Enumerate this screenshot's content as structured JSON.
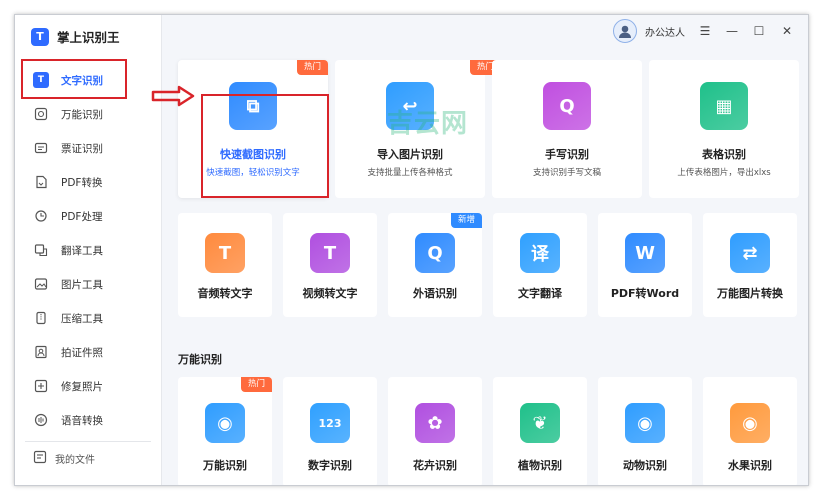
{
  "app": {
    "title": "掌上识别王",
    "logo_glyph": "T"
  },
  "user": {
    "name": "办公达人"
  },
  "window_controls": [
    "☰",
    "—",
    "☐",
    "✕"
  ],
  "sidebar": {
    "items": [
      {
        "label": "文字识别",
        "icon": "text-icon",
        "active": true
      },
      {
        "label": "万能识别",
        "icon": "scan-icon"
      },
      {
        "label": "票证识别",
        "icon": "ticket-icon"
      },
      {
        "label": "PDF转换",
        "icon": "pdf-convert-icon"
      },
      {
        "label": "PDF处理",
        "icon": "pdf-process-icon"
      },
      {
        "label": "翻译工具",
        "icon": "translate-icon"
      },
      {
        "label": "图片工具",
        "icon": "image-icon"
      },
      {
        "label": "压缩工具",
        "icon": "compress-icon"
      },
      {
        "label": "拍证件照",
        "icon": "id-photo-icon"
      },
      {
        "label": "修复照片",
        "icon": "repair-icon"
      },
      {
        "label": "语音转换",
        "icon": "voice-icon"
      }
    ],
    "bottom": {
      "label": "我的文件",
      "icon": "file-icon"
    }
  },
  "top_cards": [
    {
      "title": "快速截图识别",
      "sub": "快速截图，轻松识别文字",
      "badge": "热门",
      "color": "#2f8bff",
      "glyph": "⧉"
    },
    {
      "title": "导入图片识别",
      "sub": "支持批量上传各种格式",
      "badge": "热门",
      "color": "#2f9dff",
      "glyph": "↩"
    },
    {
      "title": "手写识别",
      "sub": "支持识别手写文稿",
      "badge": "",
      "color": "#c04fe0",
      "glyph": "Q"
    },
    {
      "title": "表格识别",
      "sub": "上传表格图片，导出xlxs",
      "badge": "",
      "color": "#1fc08a",
      "glyph": "▦"
    }
  ],
  "tools": [
    {
      "title": "音频转文字",
      "badge": "",
      "color": "#ff8a3d",
      "glyph": "T"
    },
    {
      "title": "视频转文字",
      "badge": "",
      "color": "#b04fe0",
      "glyph": "T"
    },
    {
      "title": "外语识别",
      "badge": "新增",
      "color": "#2f8bff",
      "glyph": "Q"
    },
    {
      "title": "文字翻译",
      "badge": "",
      "color": "#2fa0ff",
      "glyph": "译"
    },
    {
      "title": "PDF转Word",
      "badge": "",
      "color": "#2f8bff",
      "glyph": "W"
    },
    {
      "title": "万能图片转换",
      "badge": "",
      "color": "#2f9dff",
      "glyph": "⇄"
    }
  ],
  "section": {
    "title": "万能识别"
  },
  "universal": [
    {
      "title": "万能识别",
      "badge": "热门",
      "color": "#2f9dff",
      "glyph": "◉"
    },
    {
      "title": "数字识别",
      "badge": "",
      "color": "#2fa0ff",
      "glyph": "123"
    },
    {
      "title": "花卉识别",
      "badge": "",
      "color": "#b04fe0",
      "glyph": "✿"
    },
    {
      "title": "植物识别",
      "badge": "",
      "color": "#1fc08a",
      "glyph": "❦"
    },
    {
      "title": "动物识别",
      "badge": "",
      "color": "#2f9dff",
      "glyph": "◉"
    },
    {
      "title": "水果识别",
      "badge": "",
      "color": "#ff9a3d",
      "glyph": "◉"
    }
  ],
  "watermark": "吉云网"
}
